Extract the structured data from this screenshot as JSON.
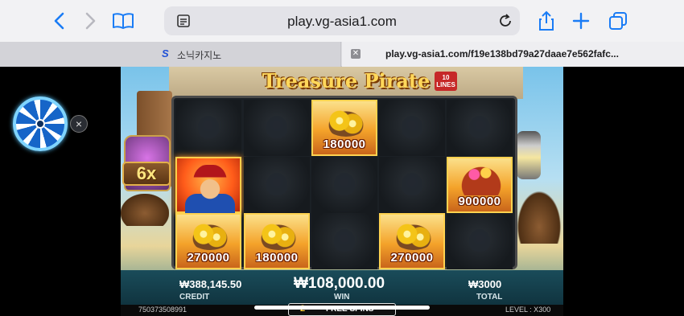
{
  "browser": {
    "url": "play.vg-asia1.com",
    "tabs": [
      {
        "label": "소닉카지노"
      },
      {
        "label": "play.vg-asia1.com/f19e138bd79a27daae7e562fafc..."
      }
    ],
    "colors": {
      "toolbar": "#f2f2f4",
      "accent": "#1a7cf5"
    }
  },
  "game": {
    "title": "Treasure Pirate",
    "lines_badge": {
      "num": "10",
      "label": "LINES"
    },
    "multiplier": "6x",
    "reels": [
      [
        {
          "type": "blank"
        },
        {
          "type": "pirate"
        },
        {
          "type": "coins",
          "value": "270000"
        }
      ],
      [
        {
          "type": "blank"
        },
        {
          "type": "blank"
        },
        {
          "type": "coins",
          "value": "180000"
        }
      ],
      [
        {
          "type": "coins",
          "value": "180000"
        },
        {
          "type": "blank"
        },
        {
          "type": "blank"
        }
      ],
      [
        {
          "type": "blank"
        },
        {
          "type": "blank"
        },
        {
          "type": "coins",
          "value": "270000"
        }
      ],
      [
        {
          "type": "blank"
        },
        {
          "type": "chest",
          "value": "900000"
        },
        {
          "type": "blank"
        }
      ]
    ],
    "credit": {
      "value": "₩388,145.50",
      "label": "CREDIT"
    },
    "win": {
      "value": "₩108,000.00",
      "label": "WIN"
    },
    "total": {
      "value": "₩3000",
      "label": "TOTAL"
    },
    "round_id": "750373508991",
    "free_spins": {
      "count": "2",
      "label": "FREE SPINS"
    },
    "level": "LEVEL : X300"
  },
  "widget": {
    "close_glyph": "×"
  }
}
